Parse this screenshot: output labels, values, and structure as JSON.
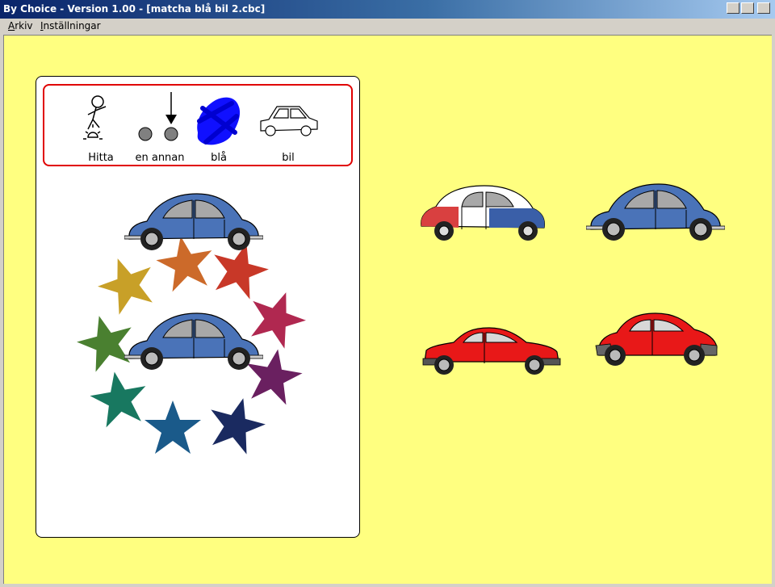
{
  "window": {
    "title": "By Choice - Version 1.00 - [matcha blå bil 2.cbc]"
  },
  "menu": {
    "items": [
      {
        "label": "Arkiv",
        "mnemonic": "A",
        "rest": "rkiv"
      },
      {
        "label": "Inställningar",
        "mnemonic": "I",
        "rest": "nställningar"
      }
    ]
  },
  "sentence": {
    "symbols": [
      {
        "label": "Hitta",
        "icon": "find-person-icon"
      },
      {
        "label": "en annan",
        "icon": "another-dots-arrow-icon"
      },
      {
        "label": "blå",
        "icon": "blue-scribble-icon"
      },
      {
        "label": "bil",
        "icon": "car-outline-icon"
      }
    ]
  },
  "colors": {
    "background": "#ffff80",
    "blue_car": "#4a73b8",
    "red_car": "#e81818",
    "sentence_border": "#e00000"
  },
  "choices": [
    {
      "name": "white-red-blue-2cv-car",
      "colors": [
        "#ffffff",
        "#d94040",
        "#3a5fa8"
      ]
    },
    {
      "name": "blue-beetle-car",
      "colors": [
        "#4a73b8"
      ]
    },
    {
      "name": "red-hatchback-car",
      "colors": [
        "#e81818"
      ]
    },
    {
      "name": "red-small-car",
      "colors": [
        "#e81818"
      ]
    }
  ],
  "stars": {
    "colors": [
      "#c8a028",
      "#cc6a2a",
      "#c83828",
      "#b02850",
      "#6a2060",
      "#1a2a60",
      "#1a5a8a",
      "#187860",
      "#4a8030"
    ]
  }
}
